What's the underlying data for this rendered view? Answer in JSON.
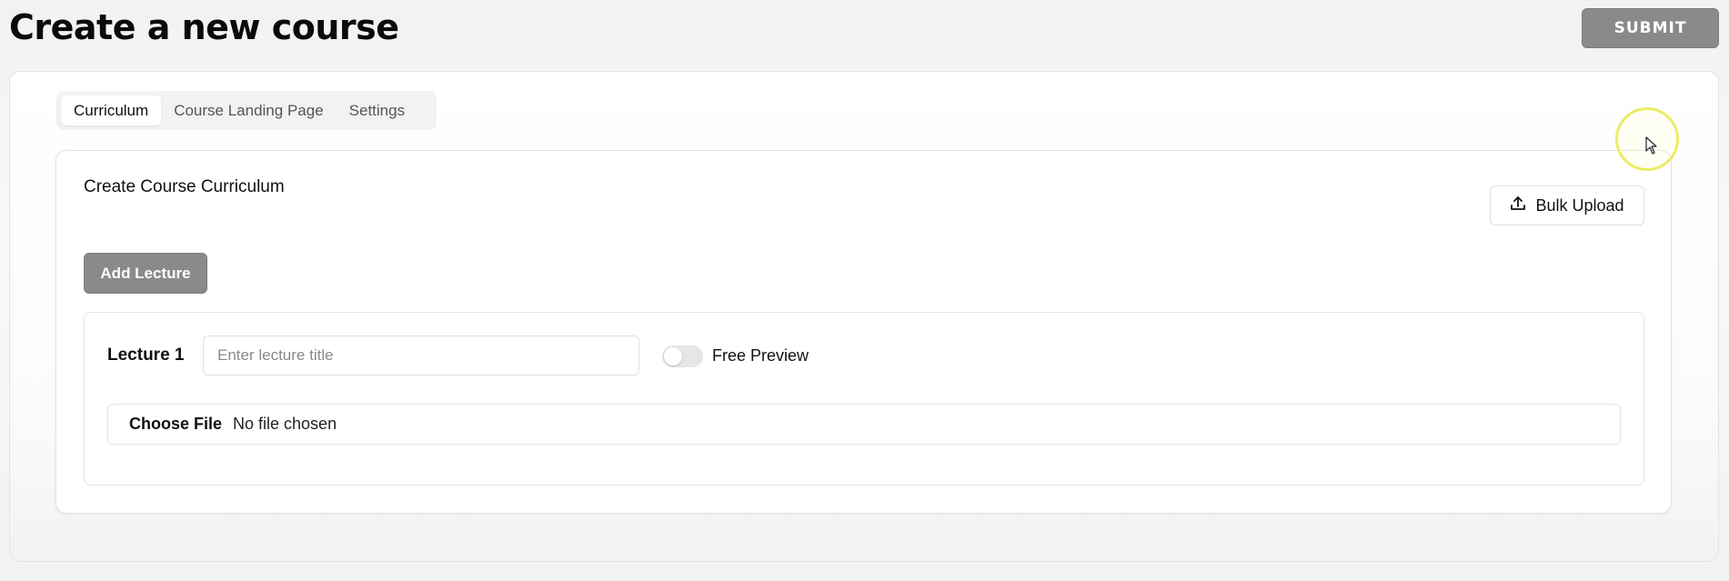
{
  "header": {
    "title": "Create a new course",
    "submit_label": "SUBMIT"
  },
  "tabs": [
    {
      "label": "Curriculum",
      "active": true
    },
    {
      "label": "Course Landing Page",
      "active": false
    },
    {
      "label": "Settings",
      "active": false
    }
  ],
  "curriculum": {
    "section_title": "Create Course Curriculum",
    "bulk_upload_label": "Bulk Upload",
    "bulk_upload_icon": "upload-icon",
    "add_lecture_label": "Add Lecture",
    "lectures": [
      {
        "label": "Lecture 1",
        "title_value": "",
        "title_placeholder": "Enter lecture title",
        "free_preview_label": "Free Preview",
        "free_preview_on": false,
        "file_button_label": "Choose File",
        "file_status": "No file chosen"
      }
    ]
  },
  "colors": {
    "primary_button": "#8a8a8a",
    "cursor_highlight": "#ecec66"
  }
}
